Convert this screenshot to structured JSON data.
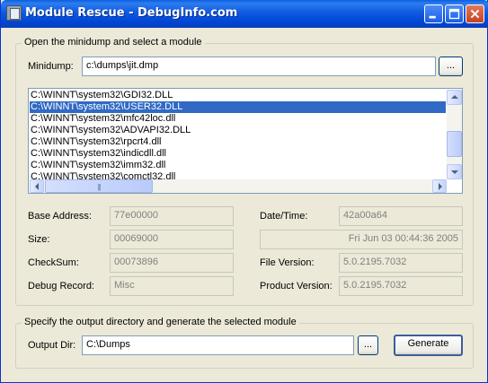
{
  "window": {
    "title": "Module Rescue - DebugInfo.com",
    "icons": {
      "app": "app-icon",
      "minimize": "minimize-icon",
      "maximize": "maximize-icon",
      "close": "close-icon"
    }
  },
  "dump_group": {
    "legend": "Open the minidump and select a module",
    "minidump_label": "Minidump:",
    "minidump_value": "c:\\dumps\\jit.dmp",
    "browse_label": "...",
    "modules": [
      "C:\\WINNT\\system32\\GDI32.DLL",
      "C:\\WINNT\\system32\\USER32.DLL",
      "C:\\WINNT\\system32\\mfc42loc.dll",
      "C:\\WINNT\\system32\\ADVAPI32.DLL",
      "C:\\WINNT\\system32\\rpcrt4.dll",
      "C:\\WINNT\\system32\\indicdll.dll",
      "C:\\WINNT\\system32\\imm32.dll",
      "C:\\WINNT\\system32\\comctl32.dll"
    ],
    "selected_index": 1
  },
  "details": {
    "base_address_label": "Base Address:",
    "base_address_value": "77e00000",
    "size_label": "Size:",
    "size_value": "00069000",
    "checksum_label": "CheckSum:",
    "checksum_value": "00073896",
    "debug_record_label": "Debug Record:",
    "debug_record_value": "Misc",
    "datetime_label": "Date/Time:",
    "datetime_value": "42a00a64",
    "datetime_text": "Fri Jun 03 00:44:36 2005",
    "file_version_label": "File Version:",
    "file_version_value": "5.0.2195.7032",
    "product_version_label": "Product Version:",
    "product_version_value": "5.0.2195.7032"
  },
  "output_group": {
    "legend": "Specify the output directory and generate the selected module",
    "output_dir_label": "Output Dir:",
    "output_dir_value": "C:\\Dumps",
    "browse_label": "...",
    "generate_label": "Generate"
  }
}
